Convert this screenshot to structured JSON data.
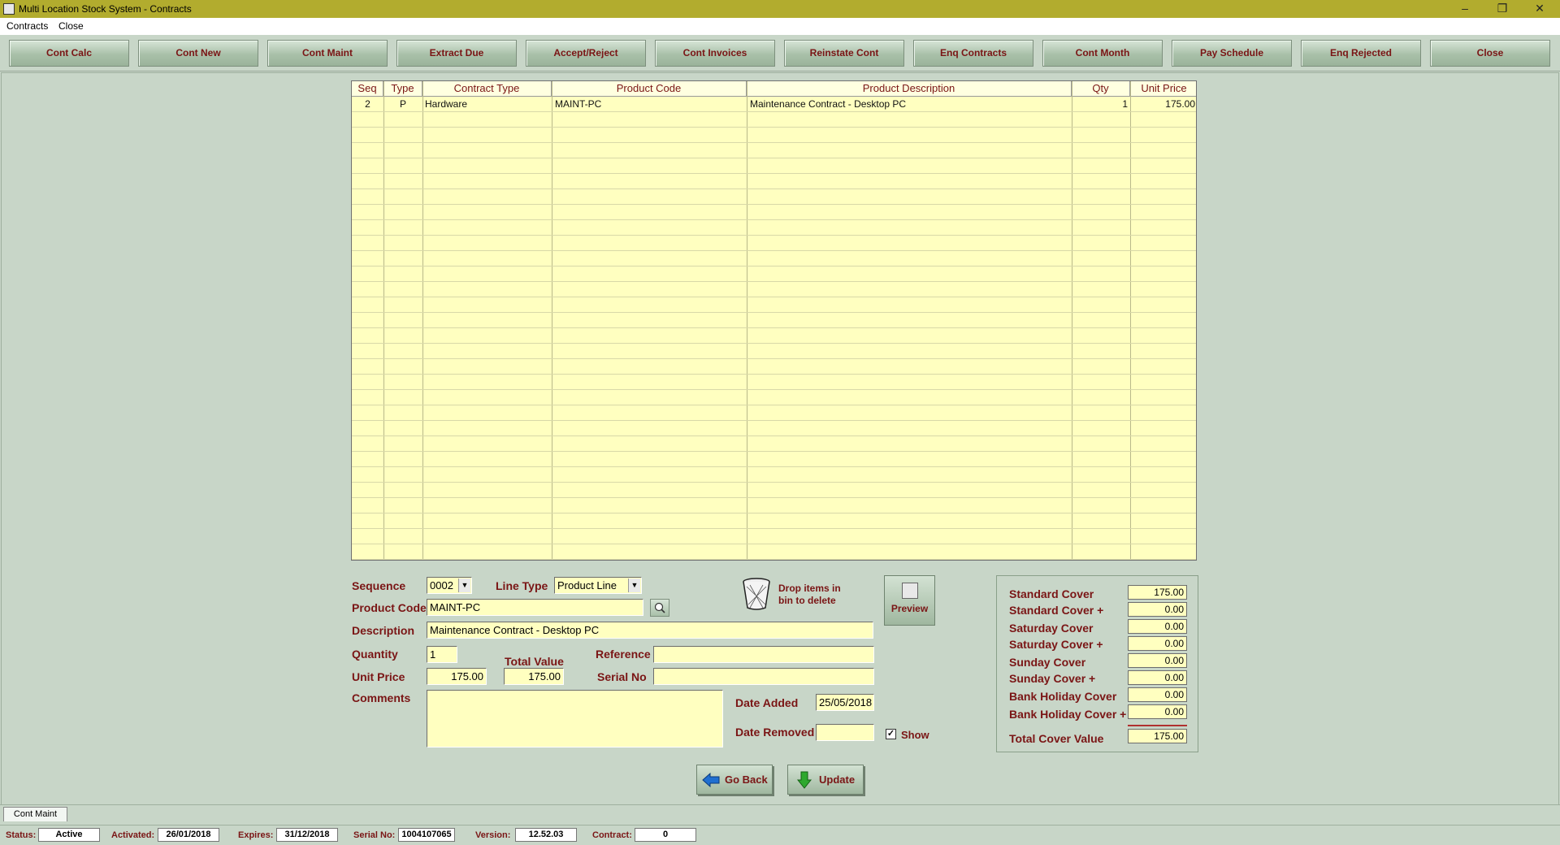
{
  "window": {
    "title": "Multi Location Stock System - Contracts",
    "minimize": "–",
    "restore": "❐",
    "close": "✕"
  },
  "menu": [
    "Contracts",
    "Close"
  ],
  "toolbar": [
    "Cont Calc",
    "Cont New",
    "Cont Maint",
    "Extract Due",
    "Accept/Reject",
    "Cont Invoices",
    "Reinstate Cont",
    "Enq Contracts",
    "Cont  Month",
    "Pay Schedule",
    "Enq Rejected",
    "Close"
  ],
  "grid": {
    "columns": [
      "Seq",
      "Type",
      "Contract Type",
      "Product Code",
      "Product Description",
      "Qty",
      "Unit Price"
    ],
    "rows": [
      {
        "seq": "2",
        "type": "P",
        "contract_type": "Hardware",
        "product_code": "MAINT-PC",
        "description": "Maintenance Contract - Desktop PC",
        "qty": "1",
        "unit_price": "175.00"
      }
    ]
  },
  "form": {
    "sequence_label": "Sequence",
    "sequence": "0002",
    "line_type_label": "Line Type",
    "line_type": "Product Line",
    "product_code_label": "Product Code",
    "product_code": "MAINT-PC",
    "description_label": "Description",
    "description": "Maintenance Contract - Desktop PC",
    "quantity_label": "Quantity",
    "quantity": "1",
    "unit_price_label": "Unit Price",
    "unit_price": "175.00",
    "total_value_label": "Total Value",
    "total_value": "175.00",
    "reference_label": "Reference",
    "reference": "",
    "serial_no_label": "Serial No",
    "serial_no": "",
    "comments_label": "Comments",
    "comments": "",
    "date_added_label": "Date Added",
    "date_added": "25/05/2018",
    "date_removed_label": "Date Removed",
    "date_removed": "",
    "show_label": "Show",
    "show_checked": true,
    "bin_text_1": "Drop items in",
    "bin_text_2": "bin to delete",
    "preview_label": "Preview"
  },
  "cover": [
    {
      "label": "Standard Cover",
      "value": "175.00"
    },
    {
      "label": "Standard Cover +",
      "value": "0.00"
    },
    {
      "label": "Saturday Cover",
      "value": "0.00"
    },
    {
      "label": "Saturday Cover +",
      "value": "0.00"
    },
    {
      "label": "Sunday Cover",
      "value": "0.00"
    },
    {
      "label": "Sunday Cover +",
      "value": "0.00"
    },
    {
      "label": "Bank Holiday Cover",
      "value": "0.00"
    },
    {
      "label": "Bank Holiday Cover +",
      "value": "0.00"
    }
  ],
  "cover_total": {
    "label": "Total Cover Value",
    "value": "175.00"
  },
  "buttons": {
    "go_back": "Go Back",
    "update": "Update"
  },
  "tab": "Cont Maint",
  "status": {
    "status_label": "Status:",
    "status": "Active",
    "activated_label": "Activated:",
    "activated": "26/01/2018",
    "expires_label": "Expires:",
    "expires": "31/12/2018",
    "serial_label": "Serial No:",
    "serial": "1004107065",
    "version_label": "Version:",
    "version": "12.52.03",
    "contract_label": "Contract:",
    "contract": "0"
  }
}
